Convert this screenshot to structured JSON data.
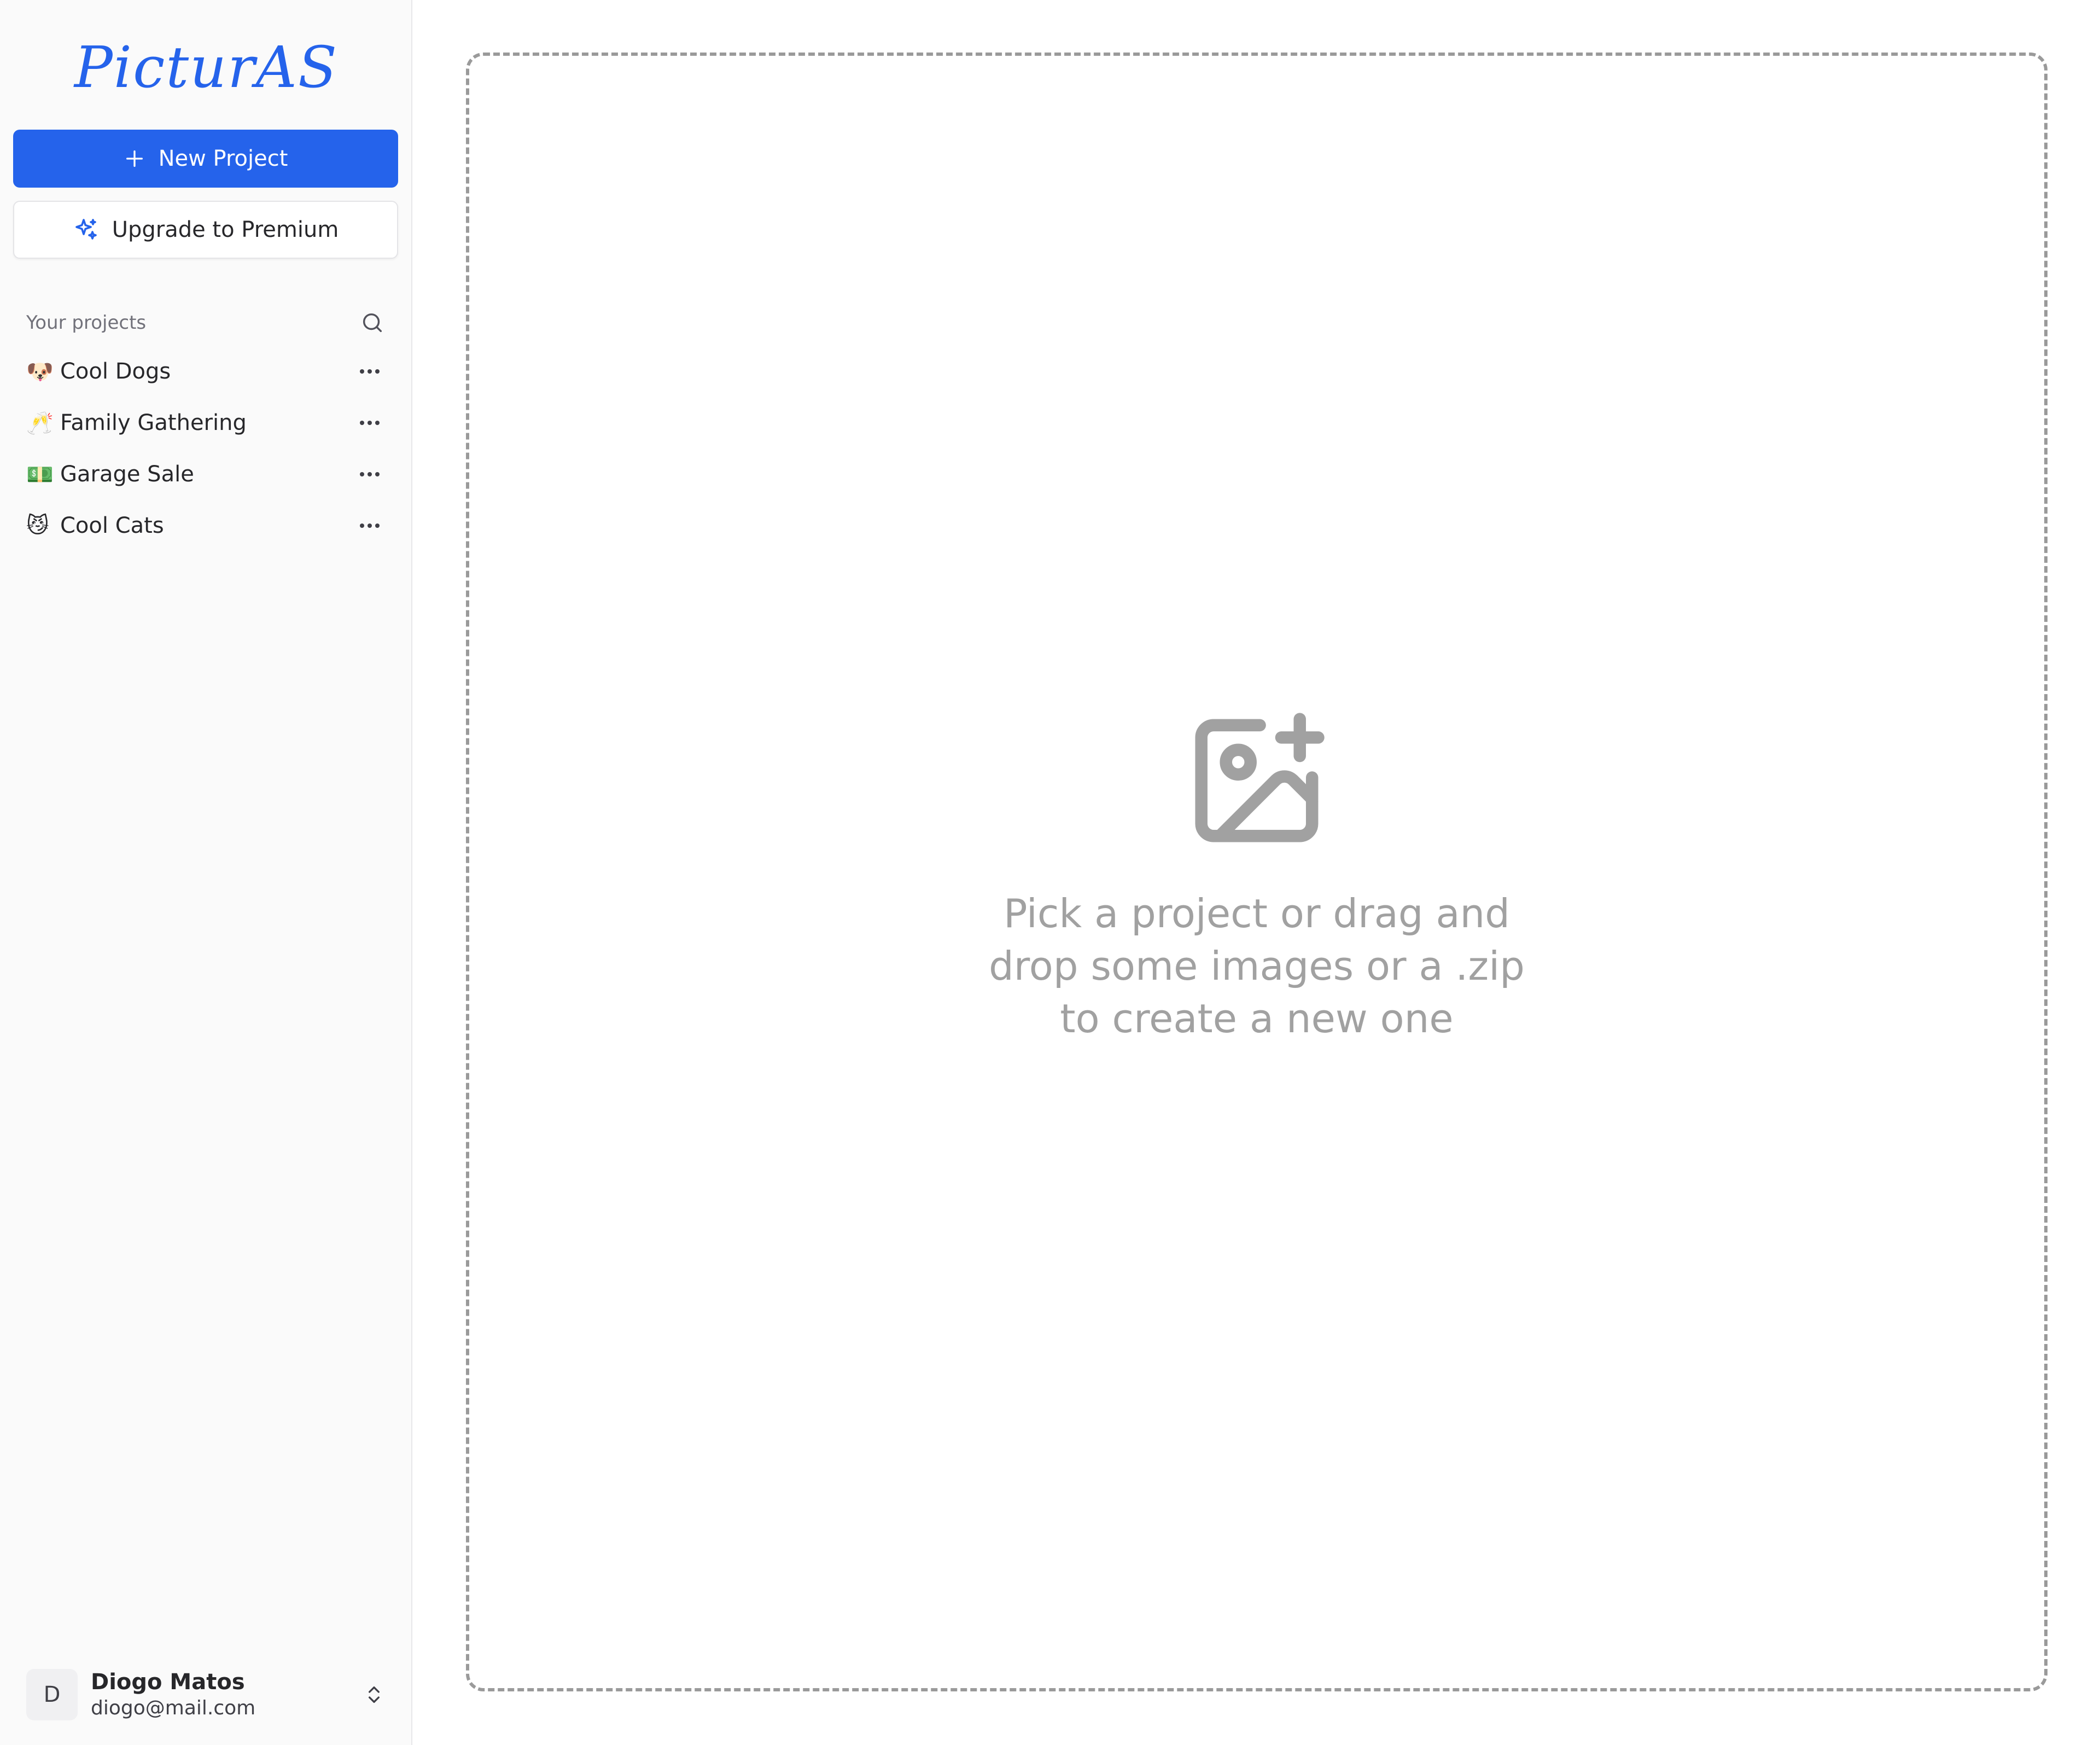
{
  "app": {
    "logo_text": "PicturAS"
  },
  "sidebar": {
    "new_project_label": "New Project",
    "upgrade_label": "Upgrade to Premium",
    "projects_title": "Your projects",
    "projects": [
      {
        "emoji": "🐶",
        "label": "Cool Dogs"
      },
      {
        "emoji": "🥂",
        "label": "Family Gathering"
      },
      {
        "emoji": "💵",
        "label": "Garage Sale"
      },
      {
        "emoji": "😼",
        "label": "Cool Cats"
      }
    ]
  },
  "user": {
    "initial": "D",
    "name": "Diogo Matos",
    "email": "diogo@mail.com"
  },
  "dropzone": {
    "line1": "Pick a project or drag and",
    "line2": "drop some images or a .zip",
    "line3": "to create a new one"
  },
  "colors": {
    "accent": "#2563eb",
    "muted_text": "#a1a1a1",
    "dashed_border": "#9a9a9a"
  }
}
